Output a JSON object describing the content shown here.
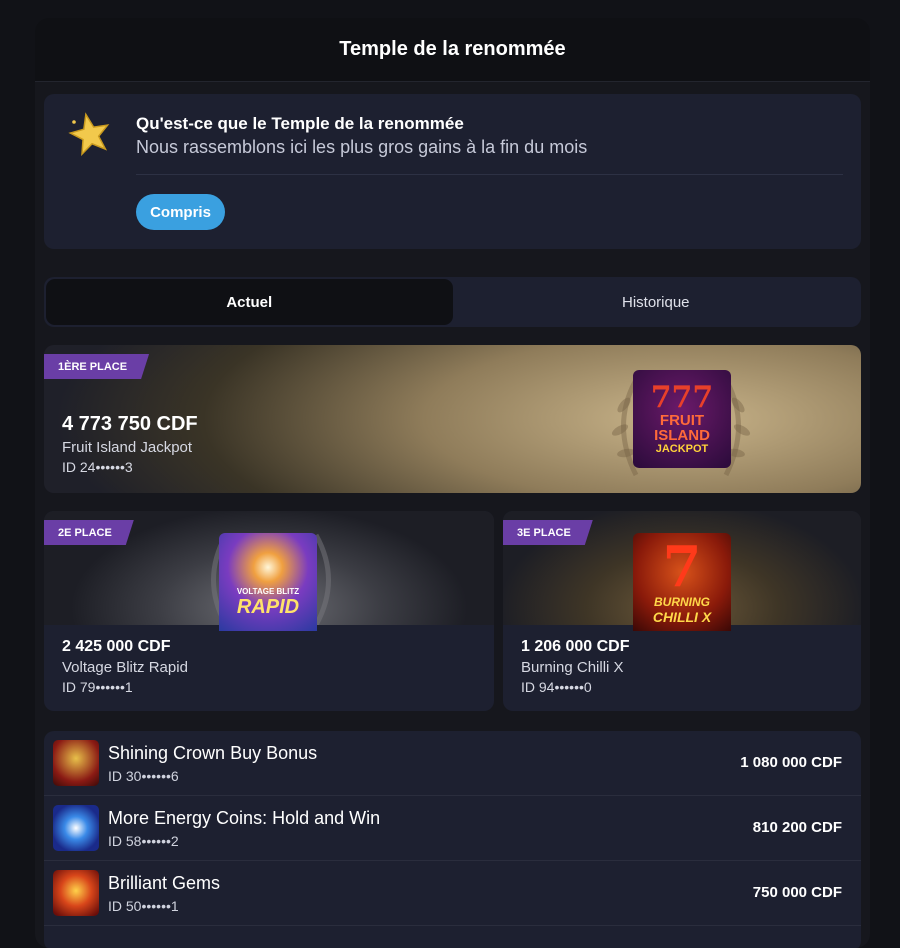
{
  "panel": {
    "title": "Temple de la renommée"
  },
  "info": {
    "icon": "star-icon",
    "heading": "Qu'est-ce que le Temple de la renommée",
    "text": "Nous rassemblons ici les plus gros gains à la fin du mois",
    "button_label": "Compris"
  },
  "tabs": [
    {
      "label": "Actuel",
      "active": true
    },
    {
      "label": "Historique",
      "active": false
    }
  ],
  "podium": {
    "first": {
      "badge": "1ÈRE PLACE",
      "amount": "4 773 750 CDF",
      "game": "Fruit Island Jackpot",
      "player_id": "ID 24••••••3",
      "thumb_text": [
        "777",
        "FRUIT",
        "ISLAND",
        "JACKPOT"
      ]
    },
    "second": {
      "badge": "2E PLACE",
      "amount": "2 425 000 CDF",
      "game": "Voltage Blitz Rapid",
      "player_id": "ID 79••••••1",
      "thumb_text": [
        "VOLTAGE BLITZ",
        "RAPID"
      ]
    },
    "third": {
      "badge": "3E PLACE",
      "amount": "1 206 000 CDF",
      "game": "Burning Chilli X",
      "player_id": "ID 94••••••0",
      "thumb_text": [
        "7",
        "BURNING",
        "CHILLI X"
      ]
    }
  },
  "list": [
    {
      "game": "Shining Crown Buy Bonus",
      "player_id": "ID 30••••••6",
      "amount": "1 080 000 CDF"
    },
    {
      "game": "More Energy Coins: Hold and Win",
      "player_id": "ID 58••••••2",
      "amount": "810 200 CDF"
    },
    {
      "game": "Brilliant Gems",
      "player_id": "ID 50••••••1",
      "amount": "750 000 CDF"
    }
  ],
  "colors": {
    "accent": "#3aa0e0",
    "badge": "#6a3ea6",
    "card": "#1d2030"
  }
}
